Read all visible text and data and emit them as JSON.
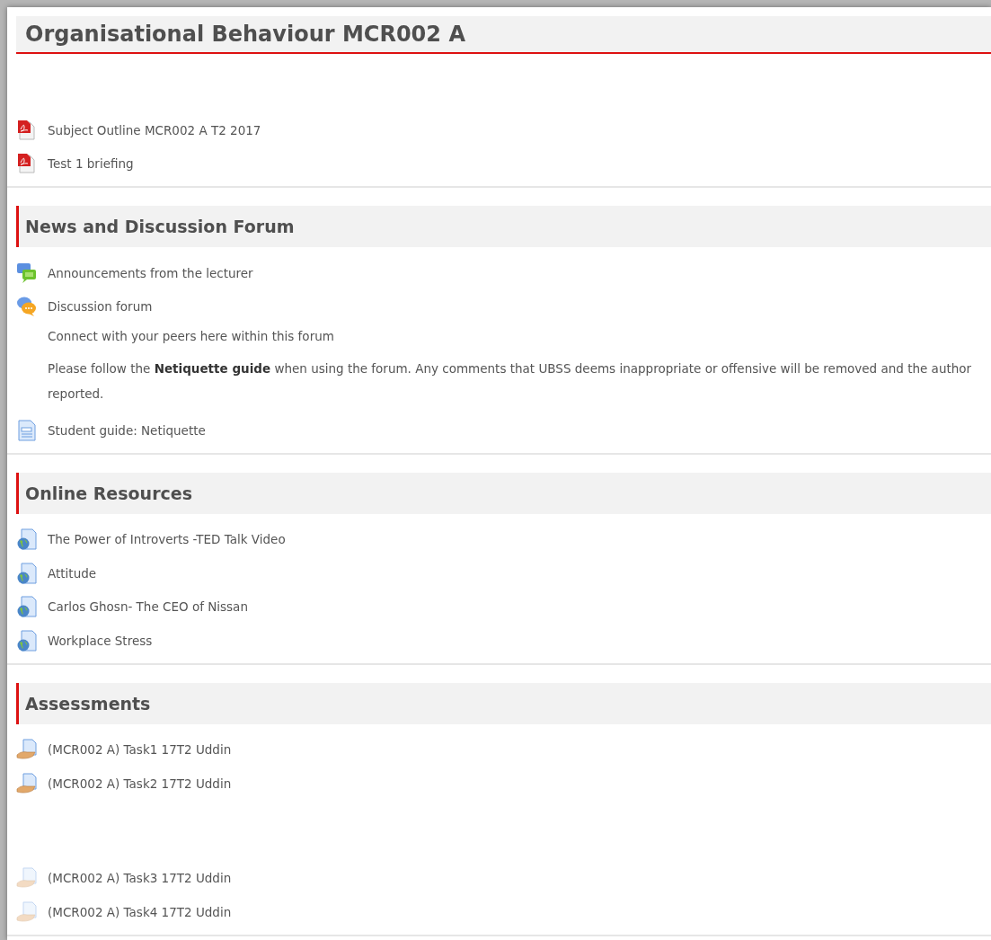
{
  "title": "Organisational Behaviour MCR002 A",
  "intro_items": [
    {
      "kind": "pdf",
      "label": "Subject Outline MCR002 A T2 2017"
    },
    {
      "kind": "pdf",
      "label": "Test 1 briefing"
    }
  ],
  "sections": [
    {
      "heading": "News and Discussion Forum",
      "items": [
        {
          "kind": "news",
          "label": "Announcements from the lecturer"
        },
        {
          "kind": "forum",
          "label": "Discussion forum",
          "descriptions": [
            "Connect with your peers here within this forum",
            "Please follow the **Netiquette guide** when using the forum. Any comments that UBSS deems inappropriate or offensive will be removed and the author reported."
          ]
        },
        {
          "kind": "page",
          "label": "Student guide: Netiquette"
        }
      ]
    },
    {
      "heading": "Online Resources",
      "items": [
        {
          "kind": "url",
          "label": "The Power of Introverts -TED Talk Video"
        },
        {
          "kind": "url",
          "label": "Attitude"
        },
        {
          "kind": "url",
          "label": "Carlos Ghosn- The CEO of Nissan"
        },
        {
          "kind": "url",
          "label": "Workplace Stress"
        }
      ]
    },
    {
      "heading": "Assessments",
      "items": [
        {
          "kind": "assign",
          "label": "(MCR002 A) Task1 17T2 Uddin",
          "dimmed": false
        },
        {
          "kind": "assign",
          "label": "(MCR002 A) Task2 17T2 Uddin",
          "dimmed": false
        }
      ],
      "later_items": [
        {
          "kind": "assign",
          "label": "(MCR002 A) Task3 17T2 Uddin",
          "dimmed": true
        },
        {
          "kind": "assign",
          "label": "(MCR002 A) Task4 17T2 Uddin",
          "dimmed": true
        }
      ]
    }
  ]
}
